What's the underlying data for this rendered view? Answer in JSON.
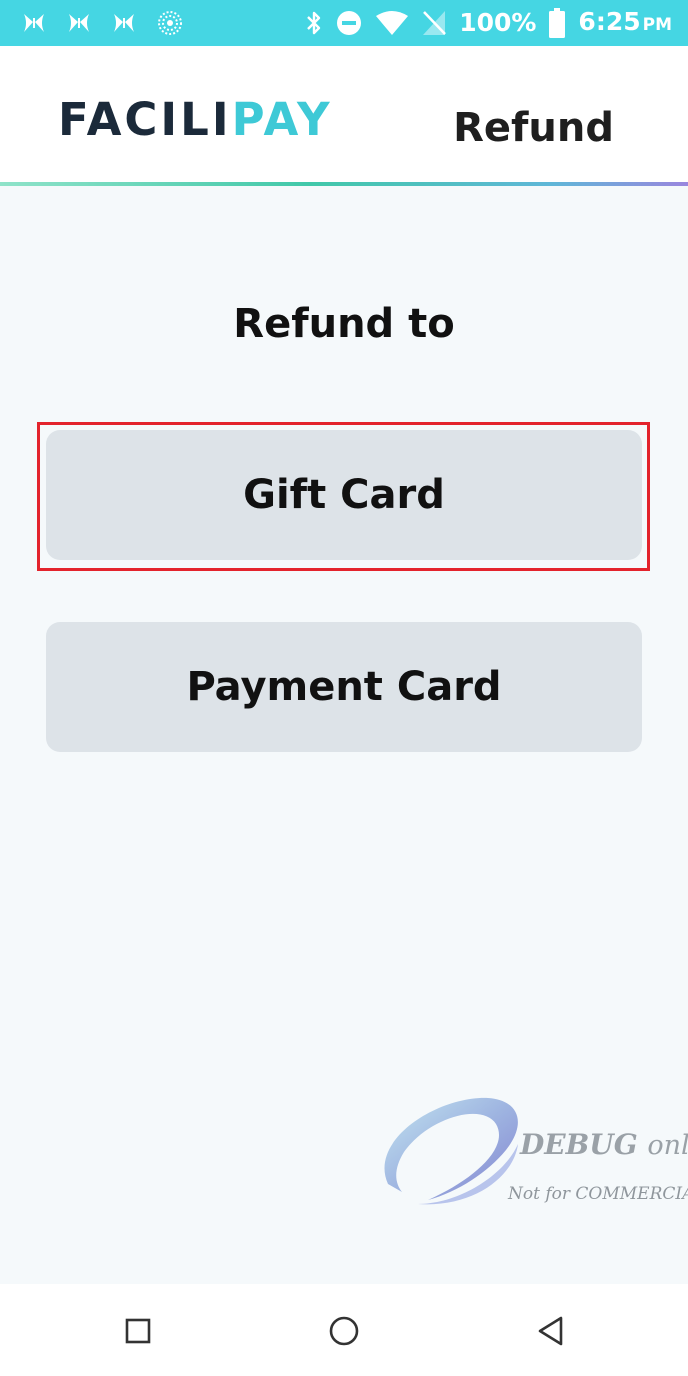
{
  "status_bar": {
    "battery_percent": "100%",
    "time": "6:25",
    "time_suffix": "PM",
    "left_icons": [
      "app-butterfly-icon",
      "app-butterfly-icon",
      "app-butterfly-icon",
      "circle-dots-icon"
    ],
    "right_icons": [
      "bluetooth-icon",
      "do-not-disturb-icon",
      "wifi-icon",
      "no-sim-icon",
      "battery-icon"
    ],
    "background_color": "#45d6e3"
  },
  "header": {
    "logo_part1": "FACILI",
    "logo_part2": "PAY",
    "title": "Refund"
  },
  "main": {
    "prompt": "Refund to",
    "options": [
      {
        "label": "Gift Card",
        "highlighted": true
      },
      {
        "label": "Payment Card",
        "highlighted": false
      }
    ]
  },
  "watermark": {
    "line1": "DEBUG",
    "line1_suffix": "only",
    "line2": "Not for COMMERCIAL"
  },
  "nav_bar": {
    "buttons": [
      "recent-apps",
      "home",
      "back"
    ]
  },
  "colors": {
    "accent": "#3ec9d6",
    "button_bg": "#dde3e8",
    "highlight": "#e3232c"
  }
}
